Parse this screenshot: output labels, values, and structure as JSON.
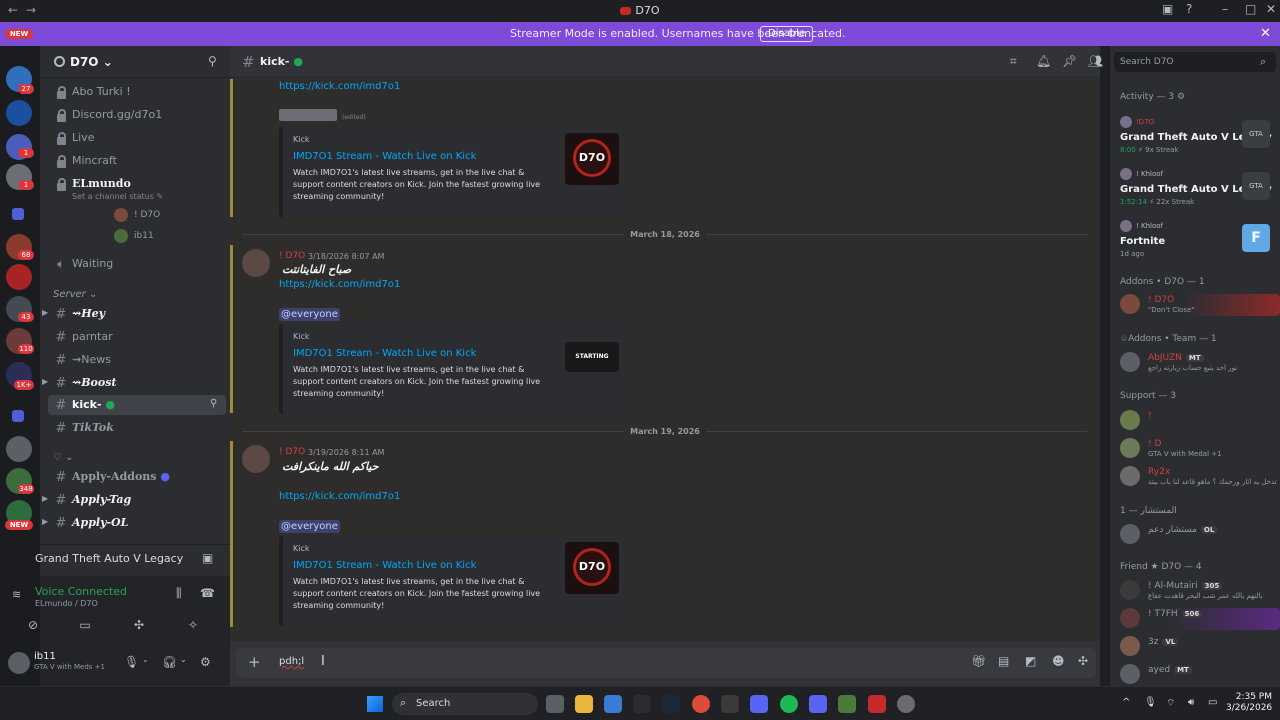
{
  "window": {
    "title": "D7O"
  },
  "banner": {
    "message": "Streamer Mode is enabled. Usernames have been truncated.",
    "button": "Disable"
  },
  "rail": {
    "badges": [
      "27",
      "1",
      "1",
      "68",
      "43",
      "110",
      "1K+",
      "348"
    ],
    "new_label": "NEW"
  },
  "guild": {
    "name": "D7O"
  },
  "channels": {
    "locked": [
      "Abo Turki !",
      "Discord.gg/d7o1",
      "Live",
      "Mincraft",
      "ELmundo"
    ],
    "status_hint": "Set a channel status",
    "voice_users": [
      "! D7O",
      "ib11"
    ],
    "waiting": "Waiting",
    "category": "Server",
    "text": [
      "⇝Hey",
      "parntar",
      "⇝News",
      "⇝Boost",
      "kick-",
      "TikTok"
    ],
    "category2": "♡",
    "text2": [
      "Apply-Addons",
      "Apply-Tag",
      "Apply-OL"
    ]
  },
  "activity_bar": {
    "game": "Grand Theft Auto V Legacy"
  },
  "voice": {
    "status": "Voice Connected",
    "location": "ELmundo / D7O"
  },
  "user": {
    "name": "ib11",
    "status": "GTA V with Meds +1"
  },
  "chat": {
    "channel": "kick-",
    "link": "https://kick.com/imd7o1",
    "edited": "(edited)",
    "embed": {
      "provider": "Kick",
      "title": "IMD7O1 Stream - Watch Live on Kick",
      "description": "Watch IMD7O1's latest live streams, get in the live chat & support content creators on Kick. Join the fastest growing live streaming community!",
      "thumb_text": "D7O",
      "thumb_small": "STARTING"
    },
    "dates": [
      "March 18, 2026",
      "March 19, 2026"
    ],
    "messages": [
      {
        "author": "! D7O",
        "time": "3/18/2026 8:07 AM",
        "text": "صباح الفايتانتت"
      },
      {
        "author": "! D7O",
        "time": "3/19/2026 8:11 AM",
        "text": "حياكم الله ماينكرافت"
      }
    ],
    "mention": "@everyone",
    "composer_value": "pdh;l"
  },
  "members": {
    "search_placeholder": "Search D7O",
    "activity_header": "Activity — 3",
    "activities": [
      {
        "user": "!D7O",
        "game": "Grand Theft Auto V Legacy",
        "time": "8:00",
        "streak": "9x Streak",
        "art": "GTA"
      },
      {
        "user": "! Khloof",
        "game": "Grand Theft Auto V Legacy",
        "time": "1:52:14",
        "streak": "22x Streak",
        "art": "GTA"
      },
      {
        "user": "! Khloof",
        "game": "Fortnite",
        "time": "",
        "streak": "1d ago",
        "art": "F"
      }
    ],
    "groups": [
      {
        "header": "Addons • D7O — 1",
        "members": [
          {
            "name": "! D7O",
            "status": "\"Don't Close\"",
            "tag": ""
          }
        ]
      },
      {
        "header": "♧Addons • Team — 1",
        "members": [
          {
            "name": "AbJUZN",
            "status": "تور احد يتبع حساب زيارته راجع",
            "tag": "MT"
          }
        ]
      },
      {
        "header": "Support — 3",
        "members": [
          {
            "name": "!",
            "status": "",
            "tag": ""
          },
          {
            "name": "! D",
            "status": "GTA V with Medal +1",
            "tag": ""
          },
          {
            "name": "Ry2x",
            "status": "تدخل يه اثار ورحمك ؟ ماهو قاعد لنا باب بيتة",
            "tag": ""
          }
        ]
      },
      {
        "header": "المستشار — 1",
        "members": [
          {
            "name": "مستشار دعم",
            "status": "",
            "tag": "OL"
          }
        ]
      },
      {
        "header": "Friend ★ D7O — 4",
        "members": [
          {
            "name": "! Al-Mutairi",
            "status": "بالتهم يالله عمر شب البحر قاهدت عقاع",
            "tag": "305"
          },
          {
            "name": "! T7FH",
            "status": "",
            "tag": "506"
          },
          {
            "name": "3z",
            "status": "",
            "tag": "VL"
          },
          {
            "name": "ayed",
            "status": "",
            "tag": "MT"
          }
        ]
      }
    ]
  },
  "taskbar": {
    "search": "Search",
    "time": "2:35 PM",
    "date": "3/26/2026"
  }
}
